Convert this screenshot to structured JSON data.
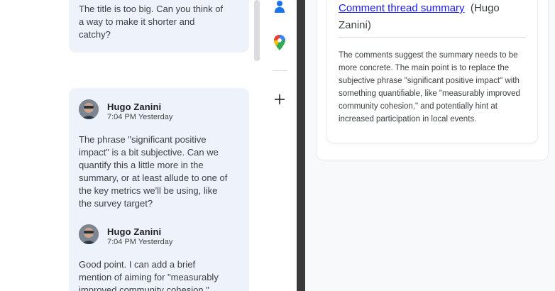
{
  "comments": {
    "first_card_text": "The title is too big. Can you think of a way to make it shorter and catchy?",
    "thread": [
      {
        "author": "Hugo Zanini",
        "time": "7:04 PM Yesterday",
        "text": "The phrase \"significant positive impact\" is a bit subjective. Can we quantify this a little more in the summary, or at least allude to one of the key metrics we'll be using, like the survey target?"
      },
      {
        "author": "Hugo Zanini",
        "time": "7:04 PM Yesterday",
        "text": "Good point. I can add a brief mention of aiming for \"measurably improved community cohesion.\""
      }
    ]
  },
  "rail": {
    "icons": [
      "contacts-icon",
      "maps-icon",
      "add-icon"
    ],
    "colors": {
      "contacts": "#1a73e8",
      "add": "#202124"
    }
  },
  "summary_panel": {
    "link_text": "Comment thread summary",
    "author": "(Hugo Zanini)",
    "body": "The comments suggest the summary needs to be more concrete. The main point is to replace the subjective phrase \"significant positive impact\" with something quantifiable, like \"measurably improved community cohesion,\" and potentially hint at increased participation in local events."
  }
}
